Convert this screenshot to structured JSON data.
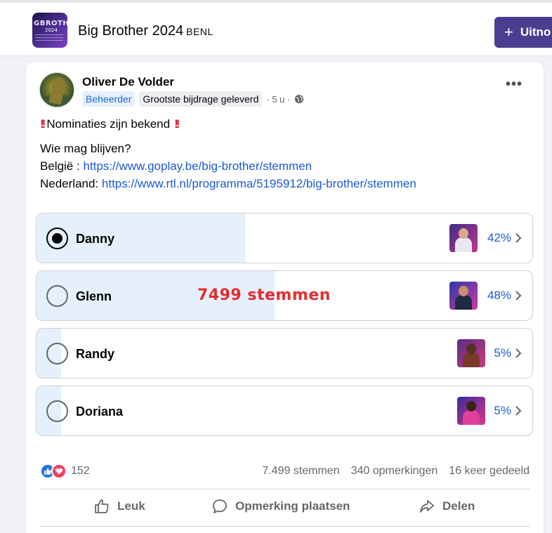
{
  "group": {
    "title": "Big Brother 2024",
    "suffix": "BENL",
    "logo_text": "GBROTHE",
    "logo_year": "2024",
    "invite_label": "Uitno"
  },
  "post": {
    "author": "Oliver De Volder",
    "badge_admin": "Beheerder",
    "badge_contributor": "Grootste bijdrage geleverd",
    "time": "· 5 u ·",
    "headline": "Nominaties zijn bekend",
    "question": "Wie mag blijven?",
    "belgium_label": "België :",
    "belgium_url": "https://www.goplay.be/big-brother/stemmen",
    "netherlands_label": "Nederland:",
    "netherlands_url": "https://www.rtl.nl/programma/5195912/big-brother/stemmen"
  },
  "poll": {
    "options": [
      {
        "label": "Danny",
        "percent_text": "42%",
        "fill_fraction": 0.42,
        "selected": true
      },
      {
        "label": "Glenn",
        "percent_text": "48%",
        "fill_fraction": 0.48,
        "selected": false
      },
      {
        "label": "Randy",
        "percent_text": "5%",
        "fill_fraction": 0.05,
        "selected": false
      },
      {
        "label": "Doriana",
        "percent_text": "5%",
        "fill_fraction": 0.05,
        "selected": false
      }
    ],
    "overlay_text": "7499 stemmen"
  },
  "footer": {
    "reaction_count": "152",
    "votes": "7.499 stemmen",
    "comments": "340 opmerkingen",
    "shares": "16 keer gedeeld",
    "like_label": "Leuk",
    "comment_label": "Opmerking plaatsen",
    "share_label": "Delen"
  },
  "colors": {
    "accent": "#1b59d6",
    "invite_button": "#4b3d8f",
    "poll_fill": "#e6f0fc",
    "overlay_red": "#e42d2d"
  }
}
